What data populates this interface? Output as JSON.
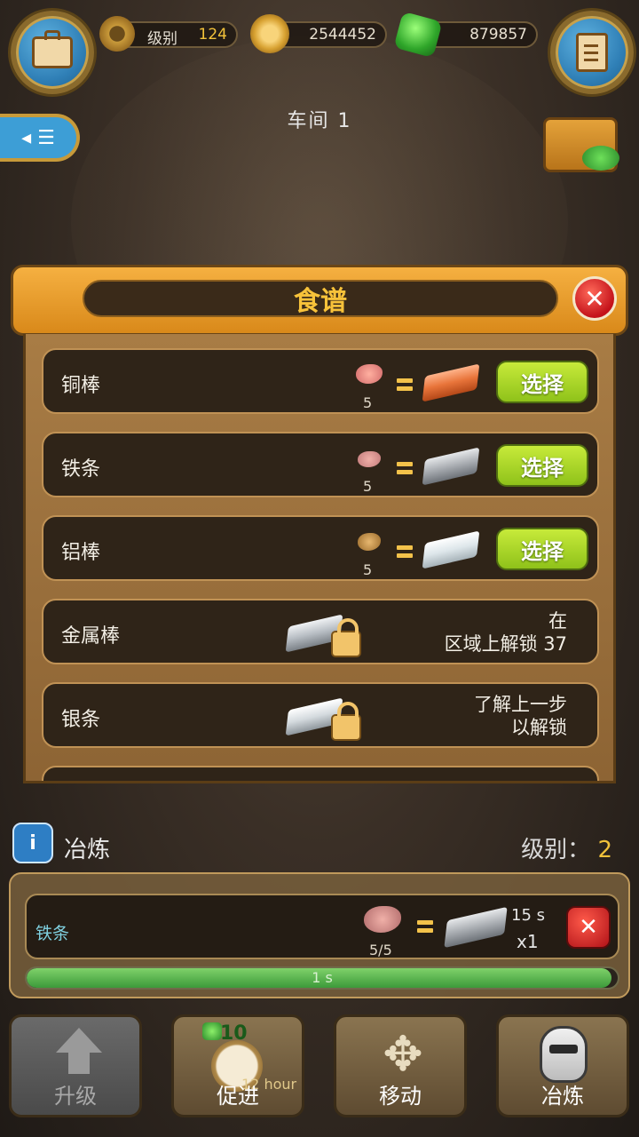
{
  "top_bar": {
    "level_label": "级别",
    "level_value": "124",
    "coins": "2544452",
    "gems": "879857",
    "left_icon": "briefcase-icon",
    "right_icon": "clipboard-icon"
  },
  "workshop_title": "车间 1",
  "recipe_panel": {
    "title": "食谱",
    "items": [
      {
        "name": "铜棒",
        "ore_count": "5",
        "button": "选择"
      },
      {
        "name": "铁条",
        "ore_count": "5",
        "button": "选择"
      },
      {
        "name": "铝棒",
        "ore_count": "5",
        "button": "选择"
      },
      {
        "name": "金属棒",
        "lock_line1": "在",
        "lock_line2": "区域上解锁 37"
      },
      {
        "name": "银条",
        "lock_line1": "了解上一步",
        "lock_line2": "以解锁"
      }
    ]
  },
  "smelt": {
    "label": "冶炼",
    "level_label": "级别：",
    "level_value": "2",
    "item_name": "铁条",
    "ore_count": "5/5",
    "time": "15 s",
    "quantity": "x1",
    "progress_text": "1 s",
    "progress": 0.99
  },
  "bottom_buttons": {
    "upgrade": "升级",
    "boost": "促进",
    "boost_gems": "10",
    "boost_hint": "12 hour",
    "move": "移动",
    "smelt": "冶炼"
  },
  "colors": {
    "gold": "#f7c23a",
    "select_green": "#a5d62a",
    "close_red": "#d8262a",
    "copper": "#e8743a",
    "iron": "#a9adb2",
    "aluminium": "#dde6ea"
  }
}
